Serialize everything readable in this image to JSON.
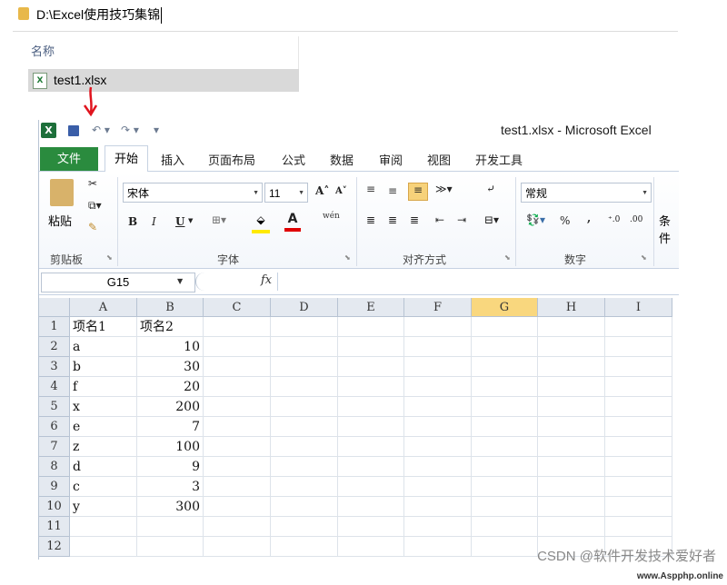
{
  "explorer": {
    "address": "D:\\Excel使用技巧集锦",
    "column_header": "名称",
    "file_name": "test1.xlsx"
  },
  "excel": {
    "window_title": "test1.xlsx - Microsoft Excel",
    "tabs": [
      "文件",
      "开始",
      "插入",
      "页面布局",
      "公式",
      "数据",
      "审阅",
      "视图",
      "开发工具"
    ],
    "clipboard": {
      "paste": "粘贴",
      "label": "剪贴板"
    },
    "font": {
      "name": "宋体",
      "size": "11",
      "label": "字体",
      "bold": "B",
      "italic": "I",
      "underline": "U",
      "grow": "A",
      "shrink": "A",
      "font_color": "A",
      "wen": "wén"
    },
    "alignment": {
      "label": "对齐方式"
    },
    "number": {
      "format": "常规",
      "label": "数字",
      "percent": "%",
      "comma": ","
    },
    "styles_partial": "条件",
    "name_box": "G15",
    "fx": "fx",
    "columns": [
      "A",
      "B",
      "C",
      "D",
      "E",
      "F",
      "G",
      "H",
      "I"
    ],
    "selected_column": "G",
    "rows": [
      {
        "n": "1",
        "a": "项名1",
        "b": "项名2"
      },
      {
        "n": "2",
        "a": "a",
        "b": "10"
      },
      {
        "n": "3",
        "a": "b",
        "b": "30"
      },
      {
        "n": "4",
        "a": "f",
        "b": "20"
      },
      {
        "n": "5",
        "a": "x",
        "b": "200"
      },
      {
        "n": "6",
        "a": "e",
        "b": "7"
      },
      {
        "n": "7",
        "a": "z",
        "b": "100"
      },
      {
        "n": "8",
        "a": "d",
        "b": "9"
      },
      {
        "n": "9",
        "a": "c",
        "b": "3"
      },
      {
        "n": "10",
        "a": "y",
        "b": "300"
      },
      {
        "n": "11",
        "a": "",
        "b": ""
      },
      {
        "n": "12",
        "a": "",
        "b": ""
      }
    ]
  },
  "watermark": "CSDN @软件开发技术爱好者",
  "watermark_small": "www.Aspphp.online",
  "colors": {
    "file_tab": "#2a8b3e",
    "selected_col": "#f9d77e",
    "arrow": "#e0141e"
  }
}
